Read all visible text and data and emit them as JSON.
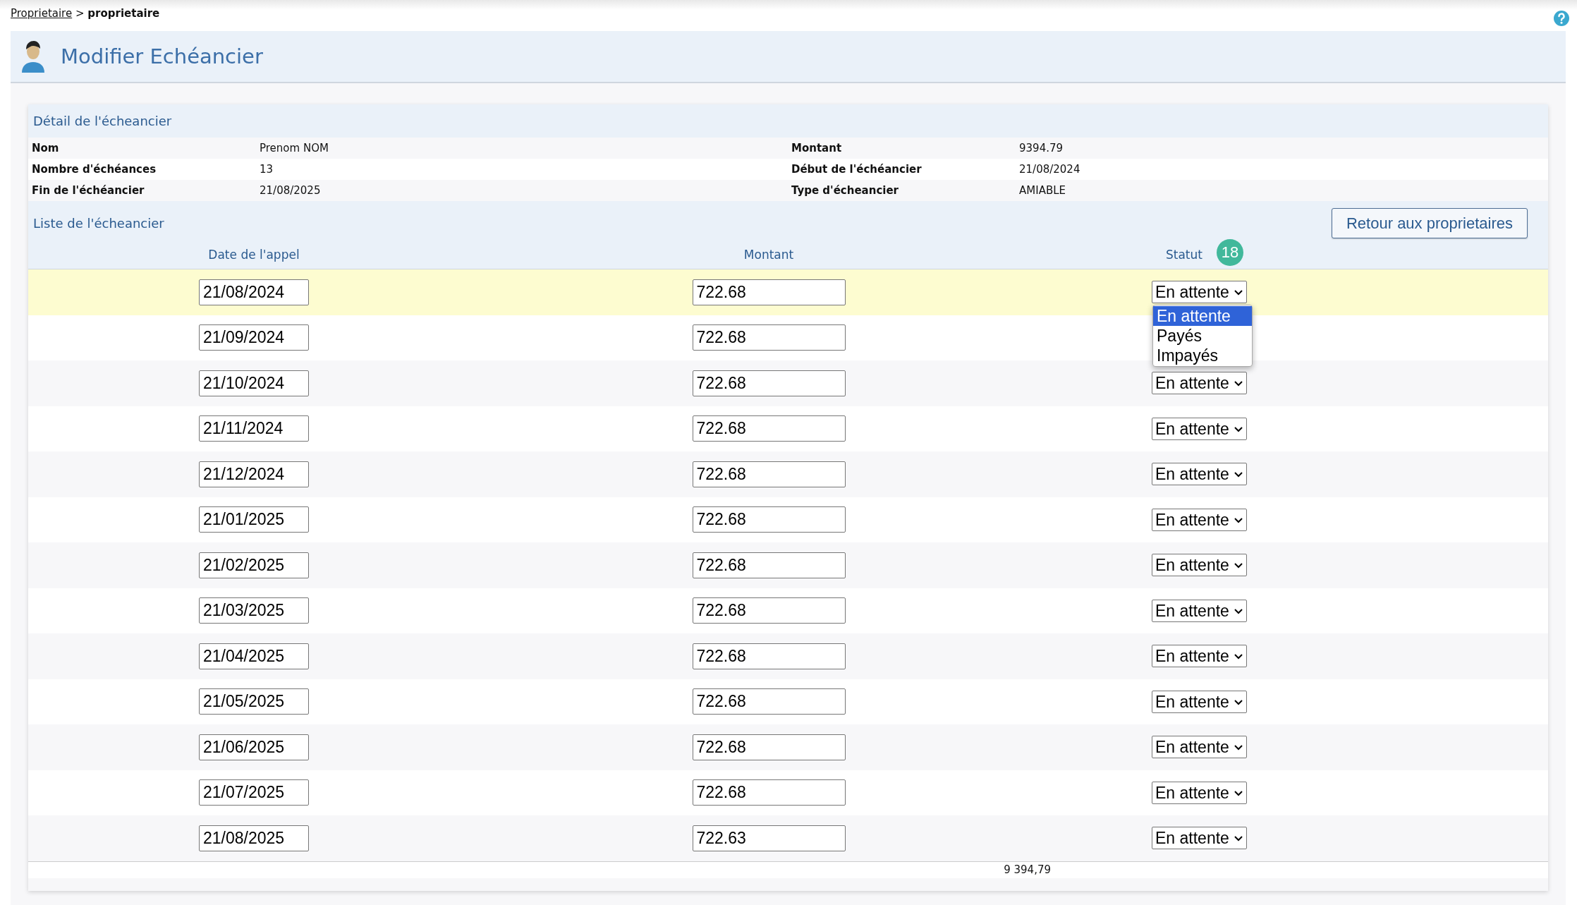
{
  "breadcrumb": {
    "link": "Proprietaire",
    "separator": ">",
    "current": "proprietaire"
  },
  "page_title": "Modifier Echéancier",
  "detail": {
    "title": "Détail de l'écheancier",
    "fields": [
      {
        "label": "Nom",
        "value": "Prenom NOM"
      },
      {
        "label": "Montant",
        "value": "9394.79"
      },
      {
        "label": "Nombre d'échéances",
        "value": "13"
      },
      {
        "label": "Début de l'échéancier",
        "value": "21/08/2024"
      },
      {
        "label": "Fin de l'échéancier",
        "value": "21/08/2025"
      },
      {
        "label": "Type d'écheancier",
        "value": "AMIABLE"
      }
    ]
  },
  "list": {
    "title": "Liste de l'écheancier",
    "back_button": "Retour aux proprietaires",
    "columns": [
      "Date de l'appel",
      "Montant",
      "Statut"
    ],
    "badge": "18",
    "rows": [
      {
        "date": "21/08/2024",
        "amount": "722.68",
        "status": "En attente",
        "highlighted": true
      },
      {
        "date": "21/09/2024",
        "amount": "722.68",
        "highlighted": false
      },
      {
        "date": "21/10/2024",
        "amount": "722.68",
        "status": "En attente",
        "highlighted": false
      },
      {
        "date": "21/11/2024",
        "amount": "722.68",
        "status": "En attente",
        "highlighted": false
      },
      {
        "date": "21/12/2024",
        "amount": "722.68",
        "status": "En attente",
        "highlighted": false
      },
      {
        "date": "21/01/2025",
        "amount": "722.68",
        "status": "En attente",
        "highlighted": false
      },
      {
        "date": "21/02/2025",
        "amount": "722.68",
        "status": "En attente",
        "highlighted": false
      },
      {
        "date": "21/03/2025",
        "amount": "722.68",
        "status": "En attente",
        "highlighted": false
      },
      {
        "date": "21/04/2025",
        "amount": "722.68",
        "status": "En attente",
        "highlighted": false
      },
      {
        "date": "21/05/2025",
        "amount": "722.68",
        "status": "En attente",
        "highlighted": false
      },
      {
        "date": "21/06/2025",
        "amount": "722.68",
        "status": "En attente",
        "highlighted": false
      },
      {
        "date": "21/07/2025",
        "amount": "722.68",
        "status": "En attente",
        "highlighted": false
      },
      {
        "date": "21/08/2025",
        "amount": "722.63",
        "status": "En attente",
        "highlighted": false
      }
    ],
    "dropdown_options": [
      {
        "label": "En attente",
        "selected": true
      },
      {
        "label": "Payés",
        "selected": false
      },
      {
        "label": "Impayés",
        "selected": false
      }
    ],
    "total": "9 394,79"
  }
}
